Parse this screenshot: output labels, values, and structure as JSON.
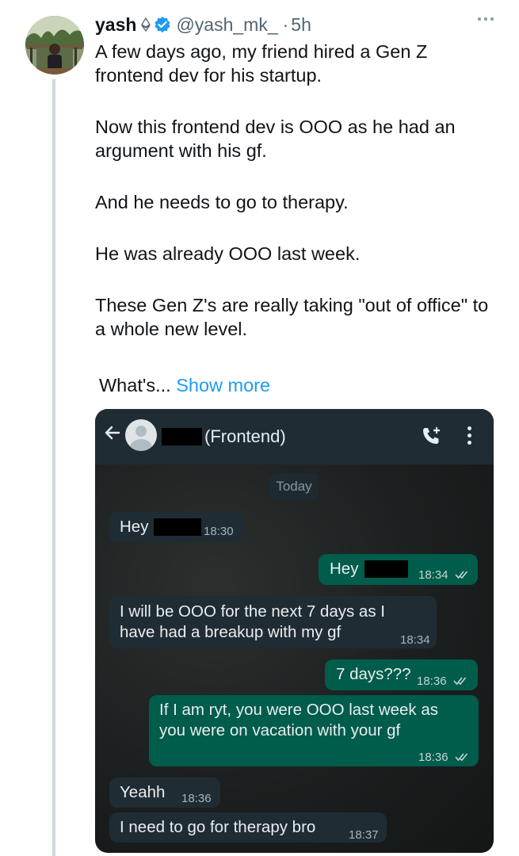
{
  "tweet": {
    "display_name": "yash",
    "handle": "@yash_mk_",
    "separator": "·",
    "time": "5h",
    "paragraphs": [
      "A few days ago, my friend hired a Gen Z frontend dev for his startup.",
      "Now this frontend dev is OOO as he had an argument with his gf.",
      "And he needs to go to therapy.",
      "He was already OOO last week.",
      "These Gen Z's are really taking \"out of office\" to a whole new level."
    ],
    "truncated_text": "What's...",
    "show_more_label": "Show more",
    "icons": {
      "more": "more-icon",
      "verified": "verified-badge-icon",
      "eth": "ethereum-icon"
    },
    "colors": {
      "link": "#1d9bf0",
      "verified": "#1d9bf0"
    }
  },
  "chat": {
    "contact_suffix": "(Frontend)",
    "date_chip": "Today",
    "icons": {
      "back": "back-arrow-icon",
      "call": "add-call-icon",
      "menu": "menu-icon"
    },
    "messages": [
      {
        "dir": "in",
        "text": "Hey",
        "time": "18:30",
        "name": "msg-1"
      },
      {
        "dir": "out",
        "text": "Hey",
        "time": "18:34",
        "name": "msg-2"
      },
      {
        "dir": "in",
        "lines": [
          "I will be OOO for the next 7 days as I",
          "have had a breakup with my gf"
        ],
        "time": "18:34",
        "name": "msg-3"
      },
      {
        "dir": "out",
        "text": "7 days???",
        "time": "18:36",
        "name": "msg-4"
      },
      {
        "dir": "out",
        "lines": [
          "If I am ryt, you were OOO last week as",
          "you were on vacation with your gf"
        ],
        "time": "18:36",
        "name": "msg-5"
      },
      {
        "dir": "in",
        "text": "Yeahh",
        "time": "18:36",
        "name": "msg-6"
      },
      {
        "dir": "in",
        "text": "I need to go for therapy bro",
        "time": "18:37",
        "name": "msg-7"
      }
    ],
    "colors": {
      "bar": "#1f2c33",
      "incoming": "#202c33",
      "outgoing": "#005c4b",
      "read_ticks": "#53bdeb"
    }
  }
}
